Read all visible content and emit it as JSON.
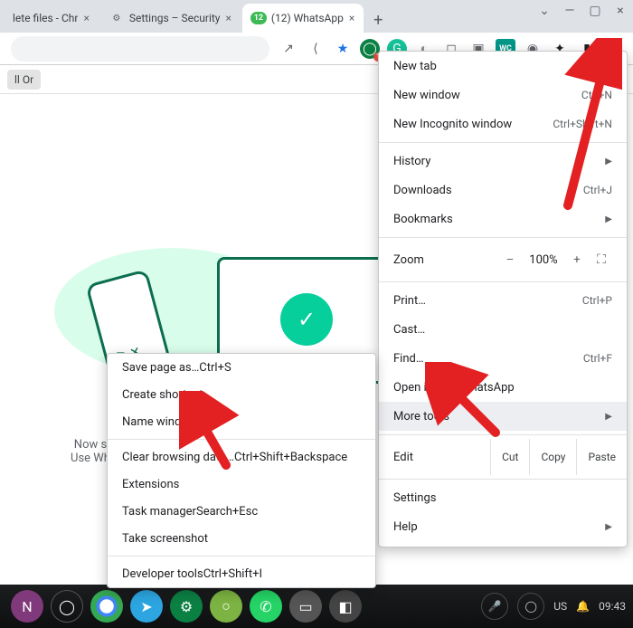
{
  "tabs": [
    {
      "title": "lete files - Chr",
      "active": false
    },
    {
      "title": "Settings – Security",
      "active": false
    },
    {
      "title": "(12) WhatsApp",
      "active": true,
      "badge": "12"
    }
  ],
  "bookmarks": {
    "item": "ll Or"
  },
  "page_text": {
    "l1": "Now s",
    "l2": "Use Wh"
  },
  "menu": {
    "new_tab": "New tab",
    "new_window": "New window",
    "new_window_sc": "Ctrl+N",
    "incognito": "New Incognito window",
    "incognito_sc": "Ctrl+Shift+N",
    "history": "History",
    "downloads": "Downloads",
    "downloads_sc": "Ctrl+J",
    "bookmarks": "Bookmarks",
    "zoom_label": "Zoom",
    "zoom_minus": "–",
    "zoom_value": "100%",
    "zoom_plus": "+",
    "print": "Print…",
    "print_sc": "Ctrl+P",
    "cast": "Cast…",
    "find": "Find…",
    "find_sc": "Ctrl+F",
    "open_in": "Open in (12) WhatsApp",
    "more_tools": "More tools",
    "edit": "Edit",
    "cut": "Cut",
    "copy": "Copy",
    "paste": "Paste",
    "settings": "Settings",
    "help": "Help"
  },
  "submenu": {
    "save_page": "Save page as…",
    "save_page_sc": "Ctrl+S",
    "create_shortcut": "Create shortcut…",
    "name_window": "Name window…",
    "clear": "Clear browsing data…",
    "clear_sc": "Ctrl+Shift+Backspace",
    "extensions": "Extensions",
    "task_manager": "Task manager",
    "task_manager_sc": "Search+Esc",
    "screenshot": "Take screenshot",
    "devtools": "Developer tools",
    "devtools_sc": "Ctrl+Shift+I"
  },
  "taskbar": {
    "lang": "US",
    "time": "09:43"
  }
}
